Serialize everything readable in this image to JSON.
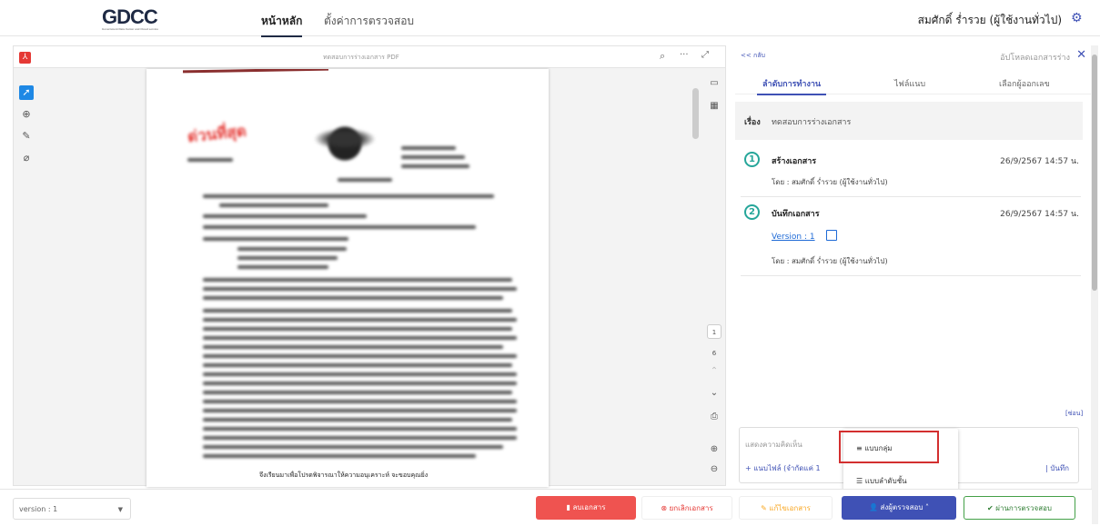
{
  "header": {
    "logo": "GDCC",
    "logo_sub": "Government Data Center and Cloud service",
    "nav_home": "หน้าหลัก",
    "nav_settings": "ตั้งค่าการตรวจสอบ",
    "user": "สมศักดิ์ ร่ำรวย (ผู้ใช้งานทั่วไป)"
  },
  "viewer": {
    "title": "ทดสอบการร่างเอกสาร",
    "file_type": "PDF",
    "doc_stamp": "ด่วนที่สุด",
    "signature_line": "จึงเรียนมาเพื่อโปรดพิจารณาให้ความอนุเคราะห์ จะขอบคุณยิ่ง",
    "page_current": "1",
    "page_total": "6"
  },
  "panel": {
    "back": "<< กลับ",
    "upload": "อัปโหลดเอกสารร่าง",
    "tabs": [
      "ลำดับการทำงาน",
      "ไฟล์แนบ",
      "เลือกผู้ออกเลข"
    ],
    "subject_label": "เรื่อง",
    "subject": "ทดสอบการร่างเอกสาร",
    "steps": [
      {
        "num": "1",
        "name": "สร้างเอกสาร",
        "date": "26/9/2567 14:57 น.",
        "by": "โดย : สมศักดิ์ ร่ำรวย (ผู้ใช้งานทั่วไป)"
      },
      {
        "num": "2",
        "name": "บันทึกเอกสาร",
        "date": "26/9/2567 14:57 น.",
        "version": "Version : 1",
        "by": "โดย : สมศักดิ์ ร่ำรวย (ผู้ใช้งานทั่วไป)"
      }
    ],
    "hide": "[ซ่อน]",
    "comment_placeholder": "แสดงความคิดเห็น",
    "attach": "+ แนบไฟล์ (จำกัดแค่ 1",
    "save": "| บันทึก"
  },
  "dropdown": {
    "group": "แบบกลุ่ม",
    "order": "แบบลำดับชั้น"
  },
  "footer": {
    "version": "version : 1",
    "delete": "ลบเอกสาร",
    "cancel": "ยกเลิกเอกสาร",
    "edit": "แก้ไขเอกสาร",
    "send": "ส่งผู้ตรวจสอบ",
    "pass": "ผ่านการตรวจสอบ"
  }
}
